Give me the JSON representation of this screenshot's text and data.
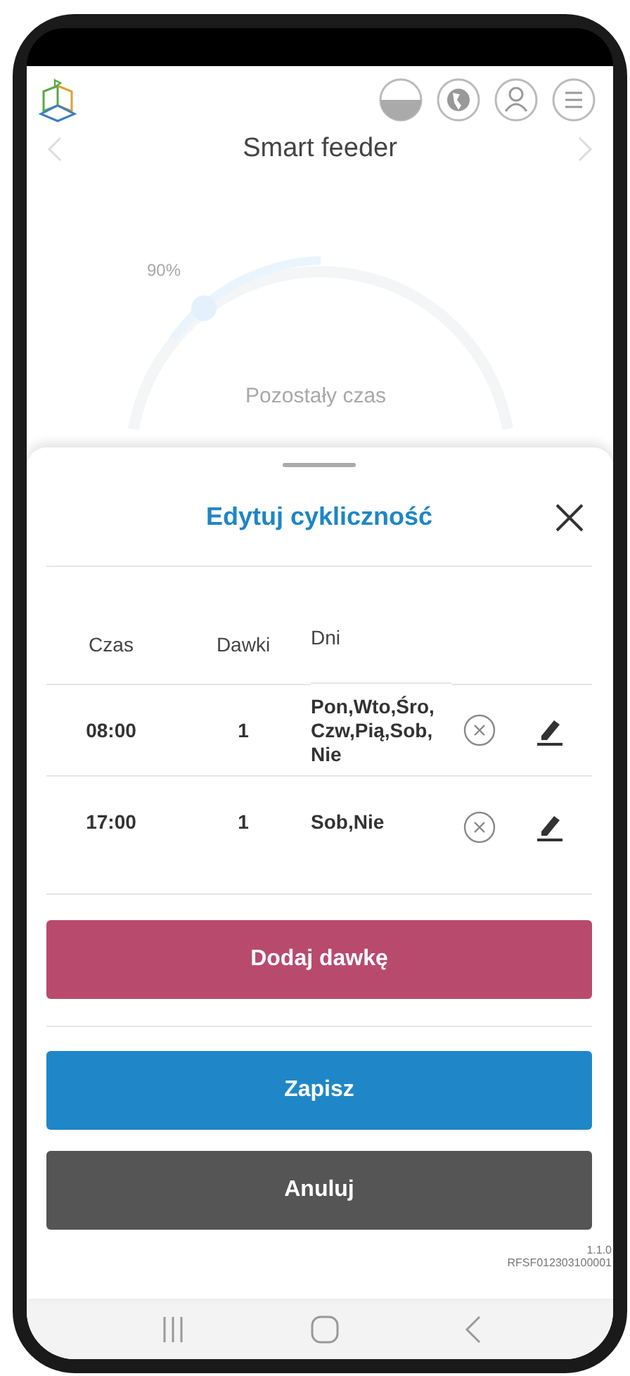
{
  "header": {
    "title": "Smart feeder"
  },
  "gauge": {
    "percent": "90%",
    "label": "Pozostały czas"
  },
  "sheet": {
    "title": "Edytuj cykliczność",
    "columns": [
      "Czas",
      "Dawki",
      "Dni"
    ],
    "rows": [
      {
        "time": "08:00",
        "doses": "1",
        "days": "Pon,Wto,Śro,Czw,Pią,Sob,Nie"
      },
      {
        "time": "17:00",
        "doses": "1",
        "days": "Sob,Nie"
      }
    ],
    "buttons": [
      {
        "label": "Dodaj dawkę",
        "kind": "add"
      },
      {
        "label": "Zapisz",
        "kind": "save"
      },
      {
        "label": "Anuluj",
        "kind": "cancel"
      }
    ],
    "version": [
      "1.1.0",
      "RFSF012303100001"
    ]
  }
}
